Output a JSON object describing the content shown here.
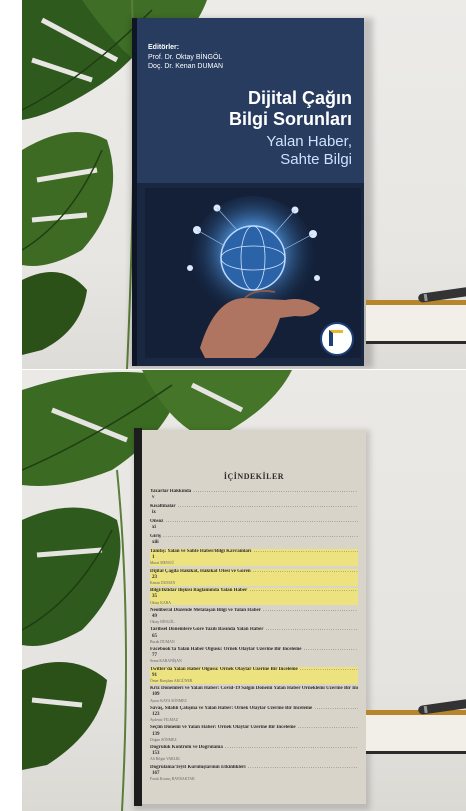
{
  "cover": {
    "editors_label": "Editörler:",
    "editors": [
      "Prof. Dr. Oktay BİNGÖL",
      "Doç. Dr. Kenan DUMAN"
    ],
    "title_lines": [
      "Dijital Çağın",
      "Bilgi Sorunları"
    ],
    "subtitle_lines": [
      "Yalan Haber,",
      "Sahte Bilgi"
    ],
    "colors": {
      "navy": "#1a2741",
      "header": "#273c5f",
      "title": "#ffffff",
      "subtitle": "#cfe0ff"
    }
  },
  "contents": {
    "heading": "İÇİNDEKİLER",
    "entries": [
      {
        "text": "Yazarlar Hakkında",
        "page": "v",
        "author": "",
        "highlight": false
      },
      {
        "text": "Kısaltmalar",
        "page": "ix",
        "author": "",
        "highlight": false
      },
      {
        "text": "Önsöz",
        "page": "xi",
        "author": "",
        "highlight": false
      },
      {
        "text": "Giriş",
        "page": "xiii",
        "author": "",
        "highlight": false
      },
      {
        "text": "Tanıtış: Yalan ve Sahte Haber/Bilgi Kavramları",
        "page": "1",
        "author": "Murat MENGÜ",
        "highlight": true
      },
      {
        "text": "Dijital Çağda Hakikat, Hakikat Ötesi ve Gören",
        "page": "23",
        "author": "Kenan DUMAN",
        "highlight": true
      },
      {
        "text": "Bilgi/İktidar İlişkisi Bağlamında Yalan Haber",
        "page": "35",
        "author": "Oktay KARA",
        "highlight": true
      },
      {
        "text": "Neoliberal Düzende Metalaşan Bilgi ve Yalan Haber",
        "page": "49",
        "author": "Oktay BİNGÖL",
        "highlight": false
      },
      {
        "text": "Tarihsel Dönemlere Göre Yazılı Basında Yalan Haber",
        "page": "65",
        "author": "Burak DUMAN",
        "highlight": false
      },
      {
        "text": "Facebook'ta Yalan Haber Olgusu: Örnek Olaylar Üzerine Bir İnceleme",
        "page": "77",
        "author": "Sema KARANİŞAN",
        "highlight": false
      },
      {
        "text": "Twitter'da Yalan Haber Olgusu: Örnek Olaylar Üzerine Bir İnceleme",
        "page": "91",
        "author": "Ömer Barışhan AKGÜNER",
        "highlight": true
      },
      {
        "text": "Kriz Dönemleri ve Yalan Haber: Covid-19 Salgın Dönemi Yalan Haber Örneklemi Üzerine Bir İnceleme",
        "page": "109",
        "author": "Aynur KAYA SÖNMEZ",
        "highlight": false
      },
      {
        "text": "Savaş, Silahlı Çatışma ve Yalan Haber: Örnek Olaylar Üzerine Bir İnceleme",
        "page": "123",
        "author": "Aydeniz YILMAZ",
        "highlight": false
      },
      {
        "text": "Seçim Dönemi ve Yalan Haber: Örnek Olaylar Üzerine Bir İnceleme",
        "page": "139",
        "author": "Doğan SÖNMEZ",
        "highlight": false
      },
      {
        "text": "Doğruluk Kontrolü ve Doğrulama",
        "page": "153",
        "author": "Ali Bilgin VARLIK",
        "highlight": false
      },
      {
        "text": "Doğrulama/Teyit Kuruluşlarının Etkinlikleri",
        "page": "167",
        "author": "Faruk Kıvanç BAYRAKTAR",
        "highlight": false
      }
    ]
  }
}
